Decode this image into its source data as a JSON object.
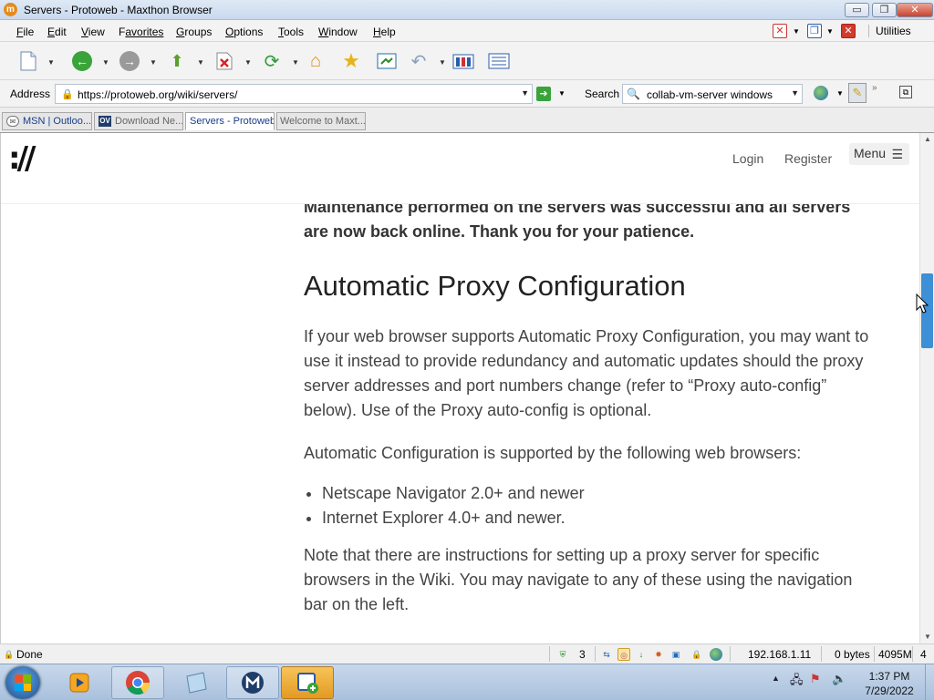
{
  "window": {
    "title": "Servers - Protoweb - Maxthon Browser",
    "min": "▭",
    "max": "❐",
    "close": "✕"
  },
  "menubar": {
    "items": [
      {
        "key": "F",
        "rest": "ile"
      },
      {
        "key": "E",
        "rest": "dit"
      },
      {
        "key": "V",
        "rest": "iew"
      },
      {
        "key": "F",
        "rest": "avorites",
        "plain": "Favorites"
      },
      {
        "key": "G",
        "rest": "roups"
      },
      {
        "key": "O",
        "rest": "ptions"
      },
      {
        "key": "T",
        "rest": "ools"
      },
      {
        "key": "W",
        "rest": "indow"
      },
      {
        "key": "H",
        "rest": "elp"
      }
    ],
    "utilities": "Utilities"
  },
  "address": {
    "label": "Address",
    "url": "https://protoweb.org/wiki/servers/"
  },
  "search": {
    "label": "Search",
    "query": "collab-vm-server windows"
  },
  "tabs": [
    {
      "label": "MSN | Outloo..."
    },
    {
      "label": "Download Ne...",
      "icon_text": "OV"
    },
    {
      "label": "Servers - Protoweb"
    },
    {
      "label": "Welcome to Maxt..."
    }
  ],
  "site": {
    "logo": "://",
    "login": "Login",
    "register": "Register",
    "menu": "Menu"
  },
  "article": {
    "notice": "Maintenance performed on the servers was successful and all servers are now back online. Thank you for your patience.",
    "heading": "Automatic Proxy Configuration",
    "p1": "If your web browser supports Automatic Proxy Configuration, you may want to use it instead to provide redundancy and automatic updates should the proxy server addresses and port numbers change (refer to “Proxy auto-config” below). Use of the Proxy auto-config is optional.",
    "p2": "Automatic Configuration is supported by the following web browsers:",
    "browsers": [
      "Netscape Navigator 2.0+ and newer",
      "Internet Explorer 4.0+ and newer."
    ],
    "p3": "Note that there are instructions for setting up a proxy server for specific browsers in the Wiki. You may navigate to any of these using the navigation bar on the left."
  },
  "status": {
    "text": "Done",
    "count": "3",
    "ip": "192.168.1.11",
    "bytes": "0 bytes",
    "memory": "4095M",
    "extra": "4"
  },
  "taskbar": {
    "time": "1:37 PM",
    "date": "7/29/2022"
  },
  "colors": {
    "accent": "#3d8fd6",
    "go": "#3aa33a",
    "active_task": "#e39a22"
  }
}
